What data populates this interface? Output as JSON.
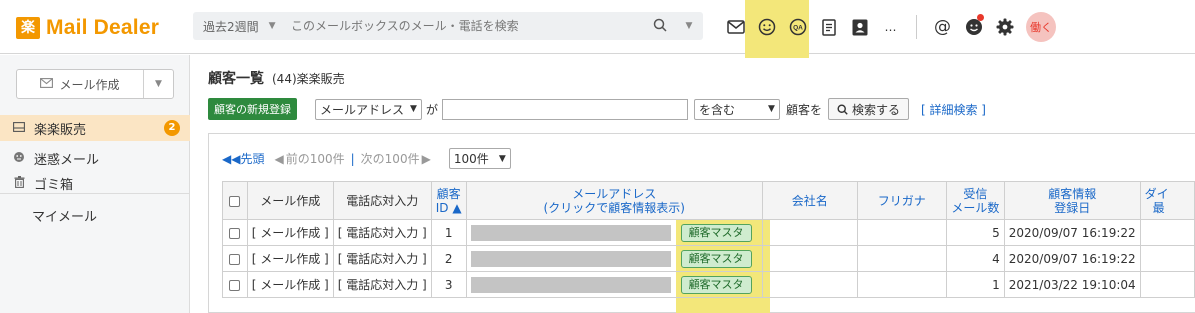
{
  "app": {
    "logo_mark": "楽",
    "logo_text": "Mail Dealer",
    "brand_color": "#f39800",
    "highlight_color": "#f3e77a"
  },
  "topbar": {
    "period_label": "過去2週間",
    "search_placeholder": "このメールボックスのメール・電話を検索",
    "icons": [
      "mail-icon",
      "smiley-icon",
      "qa-icon",
      "document-icon",
      "contact-card-icon",
      "more-icon",
      "at-icon",
      "face-notify-icon",
      "gear-icon"
    ],
    "more_label": "…",
    "at_label": "@",
    "work_label": "働く"
  },
  "sidebar": {
    "compose_label": "メール作成",
    "items": [
      {
        "label": "楽楽販売",
        "badge": "2",
        "icon": "mailbox-icon"
      },
      {
        "label": "迷惑メール",
        "icon": "spam-icon"
      },
      {
        "label": "ゴミ箱",
        "icon": "trash-icon"
      },
      {
        "label": "マイメール",
        "icon": ""
      }
    ]
  },
  "main": {
    "title": "顧客一覧",
    "subtitle": "(44)楽楽販売",
    "new_customer_label": "顧客の新規登録",
    "field_select": "メールアドレス",
    "ga_label": "が",
    "match_select": "を含む",
    "customer_label": "顧客を",
    "search_button": "検索する",
    "advanced_search": "[ 詳細検索 ]",
    "pager": {
      "first": "先頭",
      "prev": "前の100件",
      "separator": "|",
      "next": "次の100件",
      "per_page": "100件"
    },
    "table": {
      "headers": {
        "compose": "メール作成",
        "phone": "電話応対入力",
        "id_line1": "顧客",
        "id_line2": "ID ▲",
        "email_line1": "メールアドレス",
        "email_line2": "(クリックで顧客情報表示)",
        "company": "会社名",
        "furigana": "フリガナ",
        "received_line1": "受信",
        "received_line2": "メール数",
        "registered_line1": "顧客情報",
        "registered_line2": "登録日",
        "extra_line1": "ダイ",
        "extra_line2": "最"
      },
      "rows": [
        {
          "compose": "[ メール作成 ]",
          "phone": "[ 電話応対入力 ]",
          "id": "1",
          "tag": "顧客マスタ",
          "company": "",
          "furigana": "",
          "received": "5",
          "registered": "2020/09/07 16:19:22"
        },
        {
          "compose": "[ メール作成 ]",
          "phone": "[ 電話応対入力 ]",
          "id": "2",
          "tag": "顧客マスタ",
          "company": "",
          "furigana": "",
          "received": "4",
          "registered": "2020/09/07 16:19:22"
        },
        {
          "compose": "[ メール作成 ]",
          "phone": "[ 電話応対入力 ]",
          "id": "3",
          "tag": "顧客マスタ",
          "company": "",
          "furigana": "",
          "received": "1",
          "registered": "2021/03/22 19:10:04"
        }
      ]
    }
  }
}
